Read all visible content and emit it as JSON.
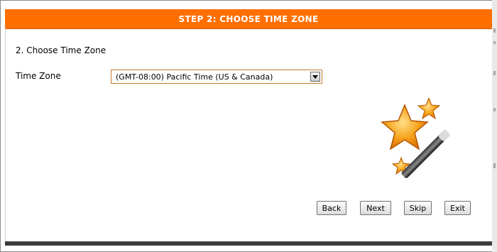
{
  "header": {
    "title": "STEP 2: CHOOSE TIME ZONE"
  },
  "section": {
    "title": "2. Choose Time Zone"
  },
  "timezone": {
    "label": "Time Zone",
    "selected": "(GMT-08:00) Pacific Time (US & Canada)"
  },
  "buttons": {
    "back": "Back",
    "next": "Next",
    "skip": "Skip",
    "exit": "Exit"
  },
  "icons": {
    "wizard": "magic-wand-with-stars-icon",
    "dropdown": "chevron-down-icon"
  },
  "colors": {
    "header_bg": "#ff6f00",
    "header_text": "#ffffff",
    "select_border": "#c97b2a"
  }
}
